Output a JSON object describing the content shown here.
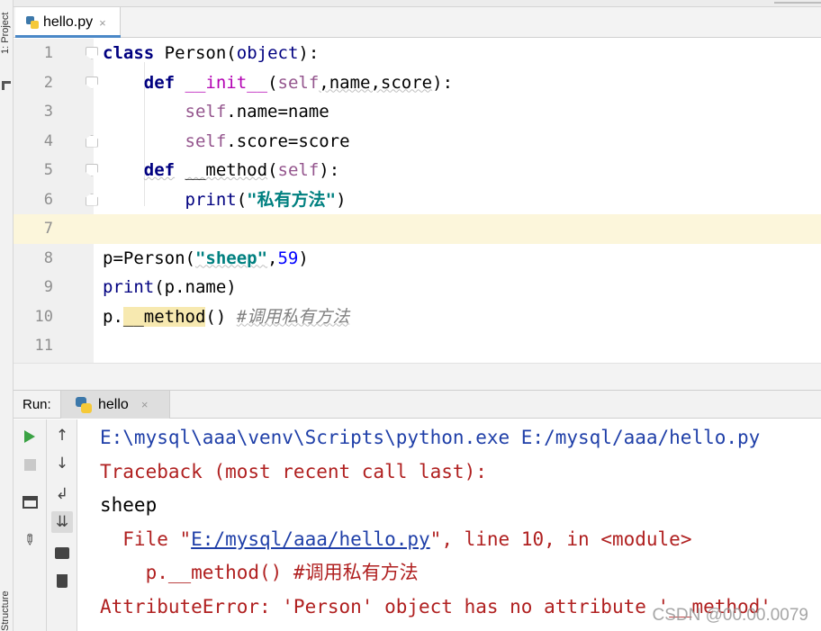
{
  "sidebar": {
    "project_label": "1: Project",
    "structure_label": "Structure"
  },
  "editor_tab": {
    "filename": "hello.py",
    "close_glyph": "×",
    "icon": "python-file-icon"
  },
  "editor": {
    "current_line": 7,
    "lines": [
      {
        "no": "1",
        "text": "class Person(object):"
      },
      {
        "no": "2",
        "text": "def __init__(self,name,score):"
      },
      {
        "no": "3",
        "text": "self.name=name"
      },
      {
        "no": "4",
        "text": "self.score=score"
      },
      {
        "no": "5",
        "text": "def __method(self):"
      },
      {
        "no": "6",
        "text": "print(\"私有方法\")"
      },
      {
        "no": "7",
        "text": ""
      },
      {
        "no": "8",
        "text": "p=Person(\"sheep\",59)"
      },
      {
        "no": "9",
        "text": "print(p.name)"
      },
      {
        "no": "10",
        "text": "p.__method() #调用私有方法"
      },
      {
        "no": "11",
        "text": ""
      }
    ],
    "tokens": {
      "class_kw": "class",
      "person": "Person",
      "object_kw": "object",
      "colon_paren": "):",
      "open_paren": "(",
      "space": " ",
      "def_kw": "def",
      "init_name": "__init__",
      "self_kw": "self",
      "init_args": ",name,score",
      "close_colon": "):",
      "name_attr": ".name=name",
      "score_attr": ".score=score",
      "method_name": "__method",
      "print_kw": "print",
      "str_private": "\"私有方法\"",
      "close_paren": ")",
      "p_assign": "p=Person(",
      "str_sheep": "\"sheep\"",
      "comma": ",",
      "num_59": "59",
      "p_name_arg": "(p.name)",
      "p_dot": "p.",
      "call_parens": "()",
      "comment": "#调用私有方法"
    }
  },
  "run_panel": {
    "label": "Run:",
    "tab_name": "hello",
    "close_glyph": "×",
    "console": [
      {
        "type": "cmd",
        "text": "E:\\mysql\\aaa\\venv\\Scripts\\python.exe E:/mysql/aaa/hello.py"
      },
      {
        "type": "err",
        "text": "Traceback (most recent call last):"
      },
      {
        "type": "out",
        "text": "sheep"
      },
      {
        "type": "err_file",
        "prefix": "  File \"",
        "link": "E:/mysql/aaa/hello.py",
        "suffix": "\", line 10, in <module>"
      },
      {
        "type": "err",
        "text": "    p.__method() #调用私有方法"
      },
      {
        "type": "err",
        "text": "AttributeError: 'Person' object has no attribute '__method'"
      }
    ]
  },
  "toolbar_icons": [
    "run-icon",
    "stop-icon",
    "layout-icon",
    "pin-icon",
    "up-arrow-icon",
    "down-arrow-icon",
    "soft-wrap-icon",
    "scroll-to-end-icon",
    "print-icon",
    "trash-icon"
  ],
  "watermark": "CSDN @00.00.0079",
  "colors": {
    "keyword": "#000080",
    "string": "#008080",
    "number": "#0000ff",
    "self": "#94558d",
    "console_cmd": "#1f3fa8",
    "console_error": "#b02020",
    "current_line": "#fcf6db",
    "tab_underline": "#4a88c7"
  }
}
